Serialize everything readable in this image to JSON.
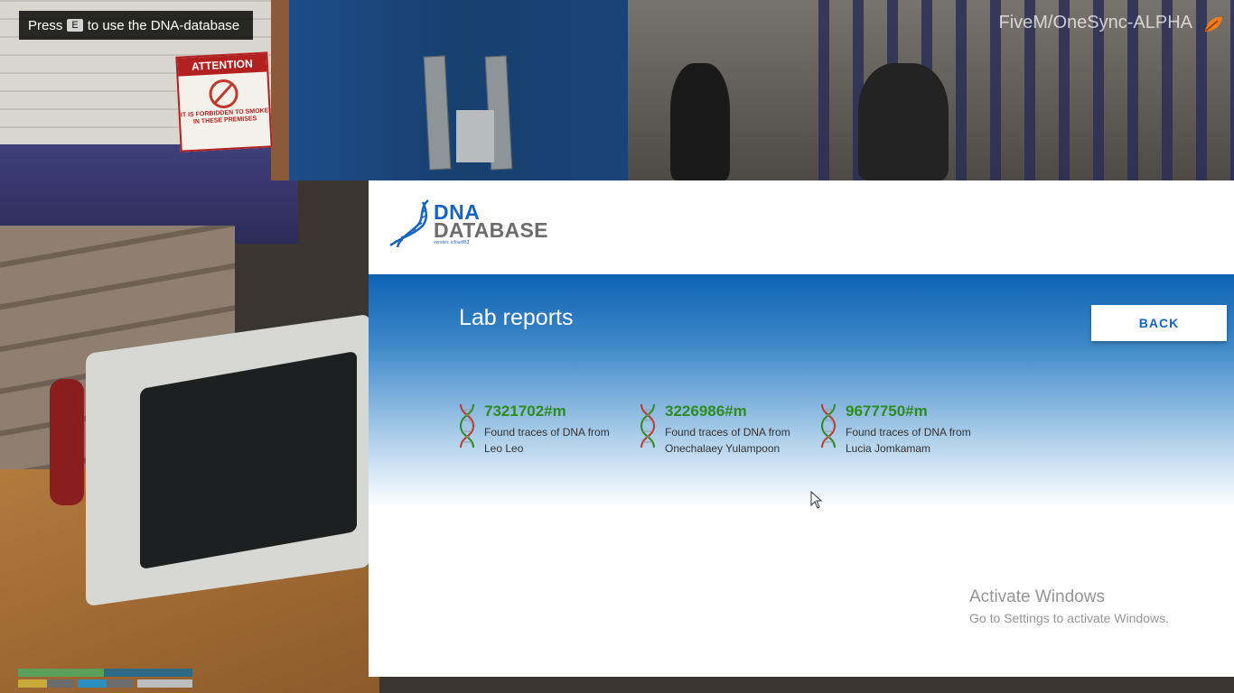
{
  "hud": {
    "prompt_pre": "Press",
    "prompt_key": "E",
    "prompt_post": "to use the DNA-database",
    "server_name": "FiveM/OneSync-ALPHA"
  },
  "scene": {
    "sign_title": "ATTENTION",
    "sign_text": "IT IS FORBIDDEN TO SMOKE IN THESE PREMISES"
  },
  "app": {
    "logo_line1": "DNA",
    "logo_line2": "DATABASE",
    "logo_version": "version: icfour853",
    "page_title": "Lab reports",
    "back_label": "BACK",
    "reports": [
      {
        "id": "7321702#m",
        "desc_line1": "Found traces of DNA from",
        "desc_line2": "Leo Leo"
      },
      {
        "id": "3226986#m",
        "desc_line1": "Found traces of DNA from",
        "desc_line2": "Onechalaey Yulampoon"
      },
      {
        "id": "9677750#m",
        "desc_line1": "Found traces of DNA from",
        "desc_line2": "Lucia Jomkamam"
      }
    ]
  },
  "os": {
    "activate_title": "Activate Windows",
    "activate_sub": "Go to Settings to activate Windows."
  },
  "colors": {
    "brand_blue": "#1565c0",
    "report_green": "#2e8b1e",
    "helix_red": "#c0392b",
    "helix_green": "#2e8b1e"
  }
}
